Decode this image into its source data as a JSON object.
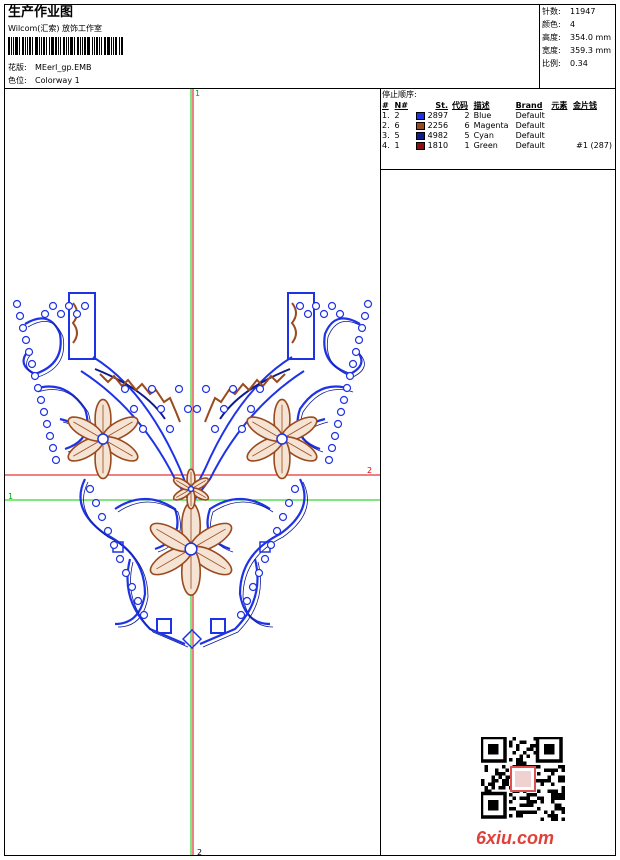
{
  "header": {
    "title": "生产作业图",
    "studio": "Wilcom(汇索) 放饰工作室",
    "design_label": "花版:",
    "design_value": "MEerl_gp.EMB",
    "colorway_label": "色位:",
    "colorway_value": "Colorway 1"
  },
  "stats": {
    "stitches_label": "针数:",
    "stitches_value": "11947",
    "colors_label": "颜色:",
    "colors_value": "4",
    "height_label": "高度:",
    "height_value": "354.0 mm",
    "width_label": "宽度:",
    "width_value": "359.3 mm",
    "scale_label": "比例:",
    "scale_value": "0.34"
  },
  "sequence": {
    "title": "停止顺序:",
    "headers": [
      "#",
      "N#",
      "St.",
      "代码",
      "描述",
      "Brand",
      "元素",
      "金片钱"
    ],
    "rows": [
      {
        "idx": "1.",
        "n": "2",
        "color": "#1f33e6",
        "st": "2897",
        "code": "2",
        "desc": "Blue",
        "brand": "Default",
        "extra": ""
      },
      {
        "idx": "2.",
        "n": "6",
        "color": "#9a4a1e",
        "st": "2256",
        "code": "6",
        "desc": "Magenta",
        "brand": "Default",
        "extra": ""
      },
      {
        "idx": "3.",
        "n": "5",
        "color": "#101a8c",
        "st": "4982",
        "code": "5",
        "desc": "Cyan",
        "brand": "Default",
        "extra": ""
      },
      {
        "idx": "4.",
        "n": "1",
        "color": "#8b0f0f",
        "st": "1810",
        "code": "1",
        "desc": "Green",
        "brand": "Default",
        "extra": "#1 (287)"
      }
    ]
  },
  "markers": {
    "top": "1",
    "bottom": "2",
    "left": "1",
    "right": "2"
  },
  "watermark": {
    "brand_text": "6xiu.com",
    "qr_label": "qr-code"
  },
  "colors": {
    "outline_blue": "#1f33e6",
    "fill_brown": "#9a4a1e",
    "guide_green": "#00cc00",
    "guide_red": "#e00000"
  }
}
